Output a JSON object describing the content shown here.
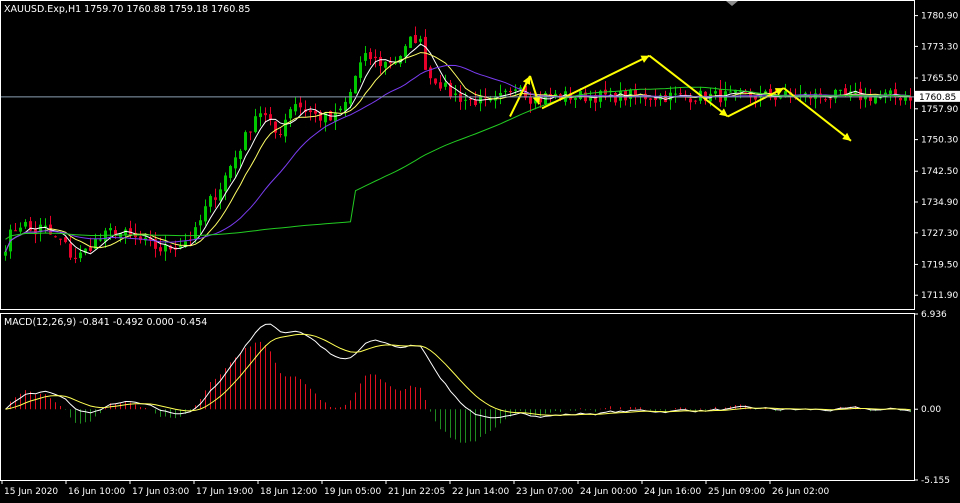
{
  "colors": {
    "background": "#000000",
    "frame": "#ffffff",
    "bull": "#00c800",
    "bear": "#e8002a",
    "ma_fast": "#ffffff",
    "ma_mid": "#ffff66",
    "ma_slow": "#7a3cf0",
    "ma_long": "#22cc22",
    "forecast": "#ffff00",
    "price_line": "#8ca0b4",
    "hist_pos": "#e01020",
    "hist_neg": "#1f8a1f",
    "macd_line": "#ffffff",
    "signal_line": "#ffff55"
  },
  "chart_data": [
    {
      "type": "candlestick",
      "title": "XAUUSD.Exp,H1  1759.70 1760.88 1759.18 1760.85",
      "symbol": "XAUUSD.Exp,H1",
      "ohlc_header": "1759.70 1760.88 1759.18 1760.85",
      "ylim": [
        1708.5,
        1784.5
      ],
      "y_ticks": [
        "1780.90",
        "1773.30",
        "1765.50",
        "1757.90",
        "1750.30",
        "1742.50",
        "1734.90",
        "1727.30",
        "1719.50",
        "1711.90"
      ],
      "current_price": "1760.85",
      "current_price_value": 1760.85,
      "x_labels": [
        "15 Jun 2020",
        "16 Jun 10:00",
        "17 Jun 03:00",
        "17 Jun 19:00",
        "18 Jun 12:00",
        "19 Jun 05:00",
        "21 Jun 22:05",
        "22 Jun 14:00",
        "23 Jun 07:00",
        "24 Jun 00:00",
        "24 Jun 16:00",
        "25 Jun 09:00",
        "26 Jun 02:00"
      ],
      "close_path": [
        [
          0,
          1723
        ],
        [
          10,
          1728
        ],
        [
          20,
          1730
        ],
        [
          30,
          1727
        ],
        [
          40,
          1729
        ],
        [
          50,
          1726
        ],
        [
          60,
          1725
        ],
        [
          70,
          1721
        ],
        [
          80,
          1722
        ],
        [
          90,
          1725
        ],
        [
          100,
          1726
        ],
        [
          110,
          1728
        ],
        [
          120,
          1727
        ],
        [
          130,
          1726
        ],
        [
          140,
          1725
        ],
        [
          150,
          1724
        ],
        [
          160,
          1723
        ],
        [
          170,
          1724
        ],
        [
          180,
          1725
        ],
        [
          192,
          1727
        ],
        [
          204,
          1734
        ],
        [
          216,
          1738
        ],
        [
          230,
          1745
        ],
        [
          245,
          1752
        ],
        [
          255,
          1758
        ],
        [
          262,
          1756
        ],
        [
          275,
          1751
        ],
        [
          290,
          1760
        ],
        [
          300,
          1758
        ],
        [
          315,
          1756
        ],
        [
          330,
          1755
        ],
        [
          345,
          1760
        ],
        [
          355,
          1768
        ],
        [
          365,
          1771
        ],
        [
          370,
          1770
        ],
        [
          380,
          1769
        ],
        [
          392,
          1770
        ],
        [
          405,
          1773
        ],
        [
          410,
          1776
        ],
        [
          418,
          1774
        ],
        [
          425,
          1766
        ],
        [
          435,
          1765
        ],
        [
          445,
          1762
        ],
        [
          455,
          1761
        ],
        [
          465,
          1760
        ],
        [
          475,
          1760
        ],
        [
          485,
          1759
        ],
        [
          495,
          1760
        ],
        [
          505,
          1762
        ],
        [
          515,
          1765
        ],
        [
          525,
          1761
        ],
        [
          535,
          1760
        ],
        [
          542,
          1761
        ]
      ],
      "moving_averages": [
        {
          "key": "ma_fast",
          "period": 5
        },
        {
          "key": "ma_mid",
          "period": 9
        },
        {
          "key": "ma_slow",
          "period": 21
        },
        {
          "key": "ma_long",
          "period": 70
        }
      ],
      "forecast_zigzag": [
        {
          "points": [
            [
              507,
              1756
            ],
            [
              527,
              1766
            ],
            [
              536,
              1759
            ]
          ]
        },
        {
          "points": [
            [
              539,
              1758
            ],
            [
              578,
              1771
            ],
            [
              606,
              1756
            ],
            [
              626,
              1763
            ],
            [
              650,
              1750
            ]
          ]
        }
      ]
    },
    {
      "type": "line",
      "title": "MACD(12,26,9) -0.841 -0.492 0.000 -0.454",
      "ylim": [
        -5.155,
        6.936
      ],
      "y_ticks": [
        "6.936",
        "0.00",
        "-5.155"
      ],
      "zero": "0.00",
      "series": [
        {
          "key": "histogram",
          "kind": "bar"
        },
        {
          "key": "macd_line",
          "kind": "line"
        },
        {
          "key": "signal_line",
          "kind": "line"
        }
      ]
    }
  ]
}
